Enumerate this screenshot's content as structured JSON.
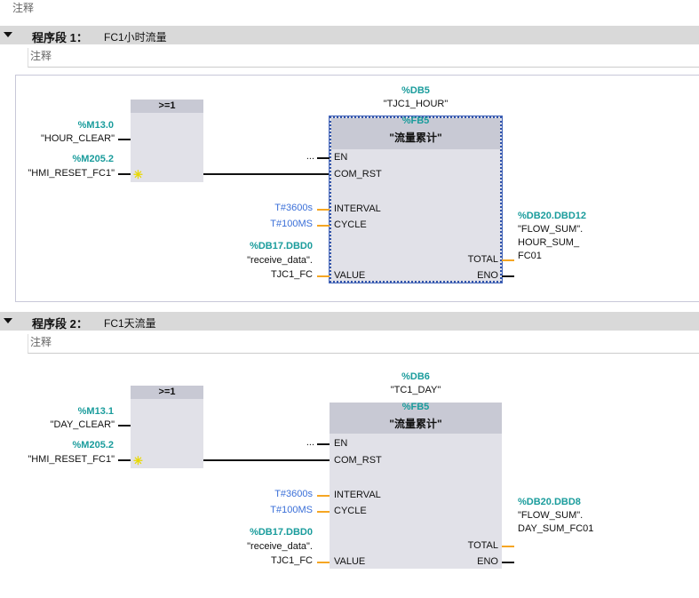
{
  "top_comment": "注释",
  "colors": {
    "address": "#1a9c9c",
    "constant": "#3a6fd8",
    "wire_data": "#f5a623",
    "header": "#d9d9d9"
  },
  "networks": [
    {
      "label": "程序段 1：",
      "title": "FC1小时流量",
      "comment": "注释",
      "or_label": ">=1",
      "in1_addr": "%M13.0",
      "in1_name": "\"HOUR_CLEAR\"",
      "in2_addr": "%M205.2",
      "in2_name": "\"HMI_RESET_FC1\"",
      "db_addr": "%DB5",
      "db_name": "\"TJC1_HOUR\"",
      "fb_addr": "%FB5",
      "fb_name": "\"流量累计\"",
      "en_value": "...",
      "pins": {
        "en": "EN",
        "com_rst": "COM_RST",
        "interval": "INTERVAL",
        "cycle": "CYCLE",
        "value": "VALUE",
        "total": "TOTAL",
        "eno": "ENO"
      },
      "interval": "T#3600s",
      "cycle": "T#100MS",
      "value_addr": "%DB17.DBD0",
      "value_line1": "\"receive_data\".",
      "value_line2": "TJC1_FC",
      "total_addr": "%DB20.DBD12",
      "total_lines": [
        "\"FLOW_SUM\".",
        "HOUR_SUM_",
        "FC01"
      ]
    },
    {
      "label": "程序段 2：",
      "title": "FC1天流量",
      "comment": "注释",
      "or_label": ">=1",
      "in1_addr": "%M13.1",
      "in1_name": "\"DAY_CLEAR\"",
      "in2_addr": "%M205.2",
      "in2_name": "\"HMI_RESET_FC1\"",
      "db_addr": "%DB6",
      "db_name": "\"TC1_DAY\"",
      "fb_addr": "%FB5",
      "fb_name": "\"流量累计\"",
      "en_value": "...",
      "pins": {
        "en": "EN",
        "com_rst": "COM_RST",
        "interval": "INTERVAL",
        "cycle": "CYCLE",
        "value": "VALUE",
        "total": "TOTAL",
        "eno": "ENO"
      },
      "interval": "T#3600s",
      "cycle": "T#100MS",
      "value_addr": "%DB17.DBD0",
      "value_line1": "\"receive_data\".",
      "value_line2": "TJC1_FC",
      "total_addr": "%DB20.DBD8",
      "total_lines": [
        "\"FLOW_SUM\".",
        "DAY_SUM_FC01"
      ]
    }
  ]
}
